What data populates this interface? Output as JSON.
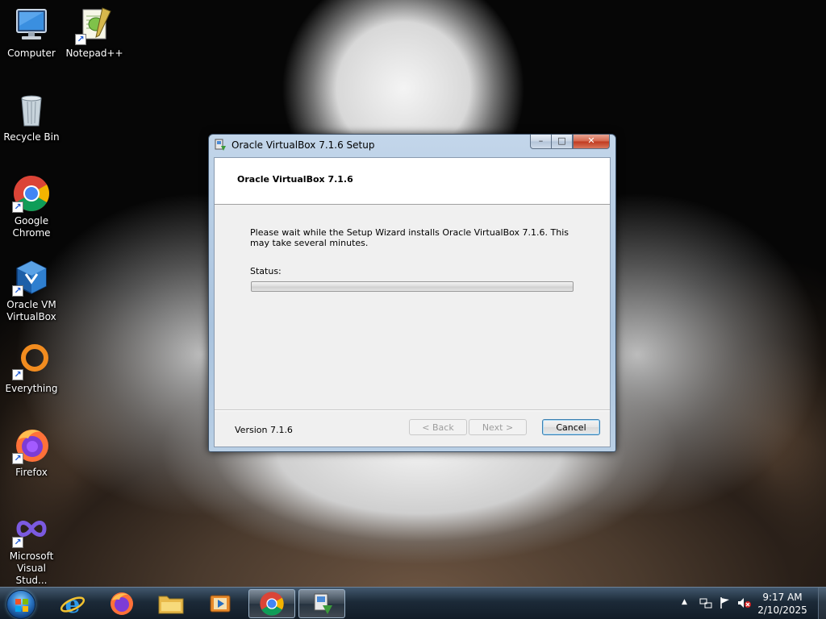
{
  "desktop": {
    "icons": [
      {
        "label": "Computer"
      },
      {
        "label": "Notepad++"
      },
      {
        "label": "Recycle Bin"
      },
      {
        "label": "Google Chrome"
      },
      {
        "label": "Oracle VM VirtualBox"
      },
      {
        "label": "Everything"
      },
      {
        "label": "Firefox"
      },
      {
        "label": "Microsoft Visual Stud..."
      }
    ]
  },
  "dialog": {
    "title": "Oracle VirtualBox 7.1.6 Setup",
    "banner_title": "Oracle VirtualBox 7.1.6",
    "description": "Please wait while the Setup Wizard installs Oracle VirtualBox 7.1.6. This may take several minutes.",
    "status_label": "Status:",
    "progress_fraction": 0.0,
    "version_label": "Version 7.1.6",
    "buttons": {
      "back": "< Back",
      "next": "Next >",
      "cancel": "Cancel"
    },
    "window_controls": {
      "minimize": "–",
      "maximize": "□",
      "close": "✕"
    }
  },
  "taskbar": {
    "apps": [
      "internet-explorer",
      "firefox",
      "file-explorer",
      "media-player",
      "chrome",
      "virtualbox-setup"
    ],
    "tray": {
      "show_hidden": "▲"
    },
    "clock": {
      "time": "9:17 AM",
      "date": "2/10/2025"
    }
  }
}
